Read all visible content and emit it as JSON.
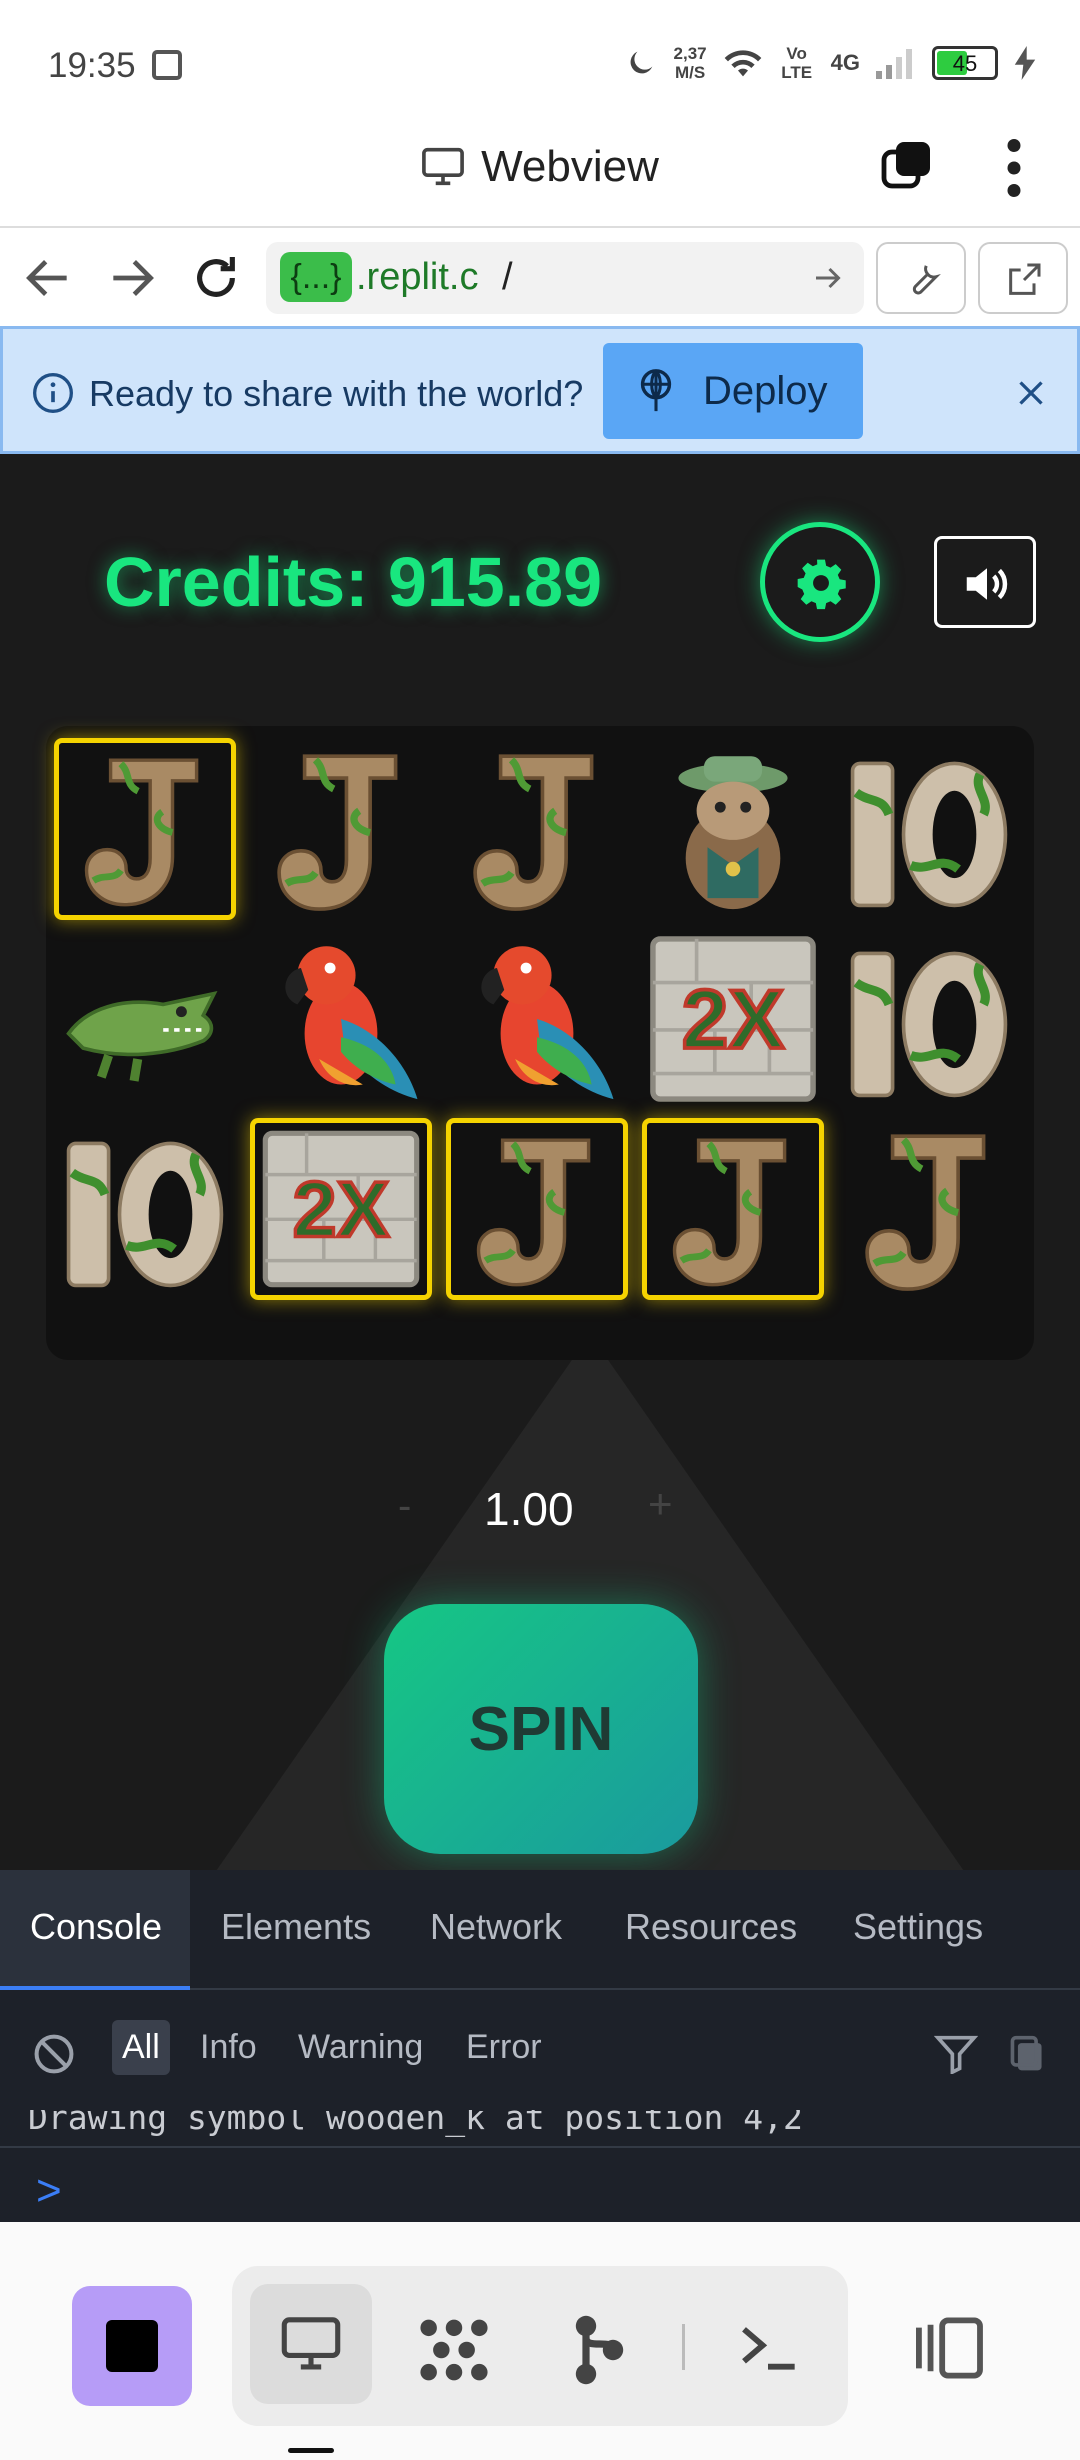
{
  "status": {
    "time": "19:35",
    "speed_value": "2,37",
    "speed_unit": "M/S",
    "volte": "Vo LTE",
    "network": "4G",
    "battery": "45"
  },
  "header": {
    "title": "Webview"
  },
  "urlbar": {
    "pill": "{...}",
    "domain": ".replit.c",
    "path": "/"
  },
  "banner": {
    "message": "Ready to share with the world?",
    "deploy_label": "Deploy"
  },
  "game": {
    "credits_label": "Credits: 915.89",
    "bet": "1.00",
    "minus": "-",
    "plus": "+",
    "spin_label": "SPIN",
    "grid": [
      [
        "wooden_j",
        "wooden_j",
        "wooden_j",
        "sloth",
        "wooden_10"
      ],
      [
        "crocodile",
        "parrot",
        "parrot",
        "stone_2x",
        "wooden_10"
      ],
      [
        "wooden_10",
        "stone_2x",
        "wooden_j",
        "wooden_j",
        "wooden_j"
      ]
    ],
    "highlighted": [
      [
        0,
        0
      ],
      [
        2,
        1
      ],
      [
        2,
        2
      ],
      [
        2,
        3
      ]
    ]
  },
  "devtools": {
    "tabs": [
      "Console",
      "Elements",
      "Network",
      "Resources",
      "Settings"
    ],
    "active_tab": "Console",
    "filters": [
      "All",
      "Info",
      "Warning",
      "Error"
    ],
    "active_filter": "All",
    "log_line": "Drawing symbol wooden_k at position 4,2",
    "prompt": ">"
  },
  "colors": {
    "accent_green": "#19e67f",
    "highlight": "#f5d300",
    "deploy_blue": "#5aa6f5",
    "stop_purple": "#b69cf7"
  }
}
